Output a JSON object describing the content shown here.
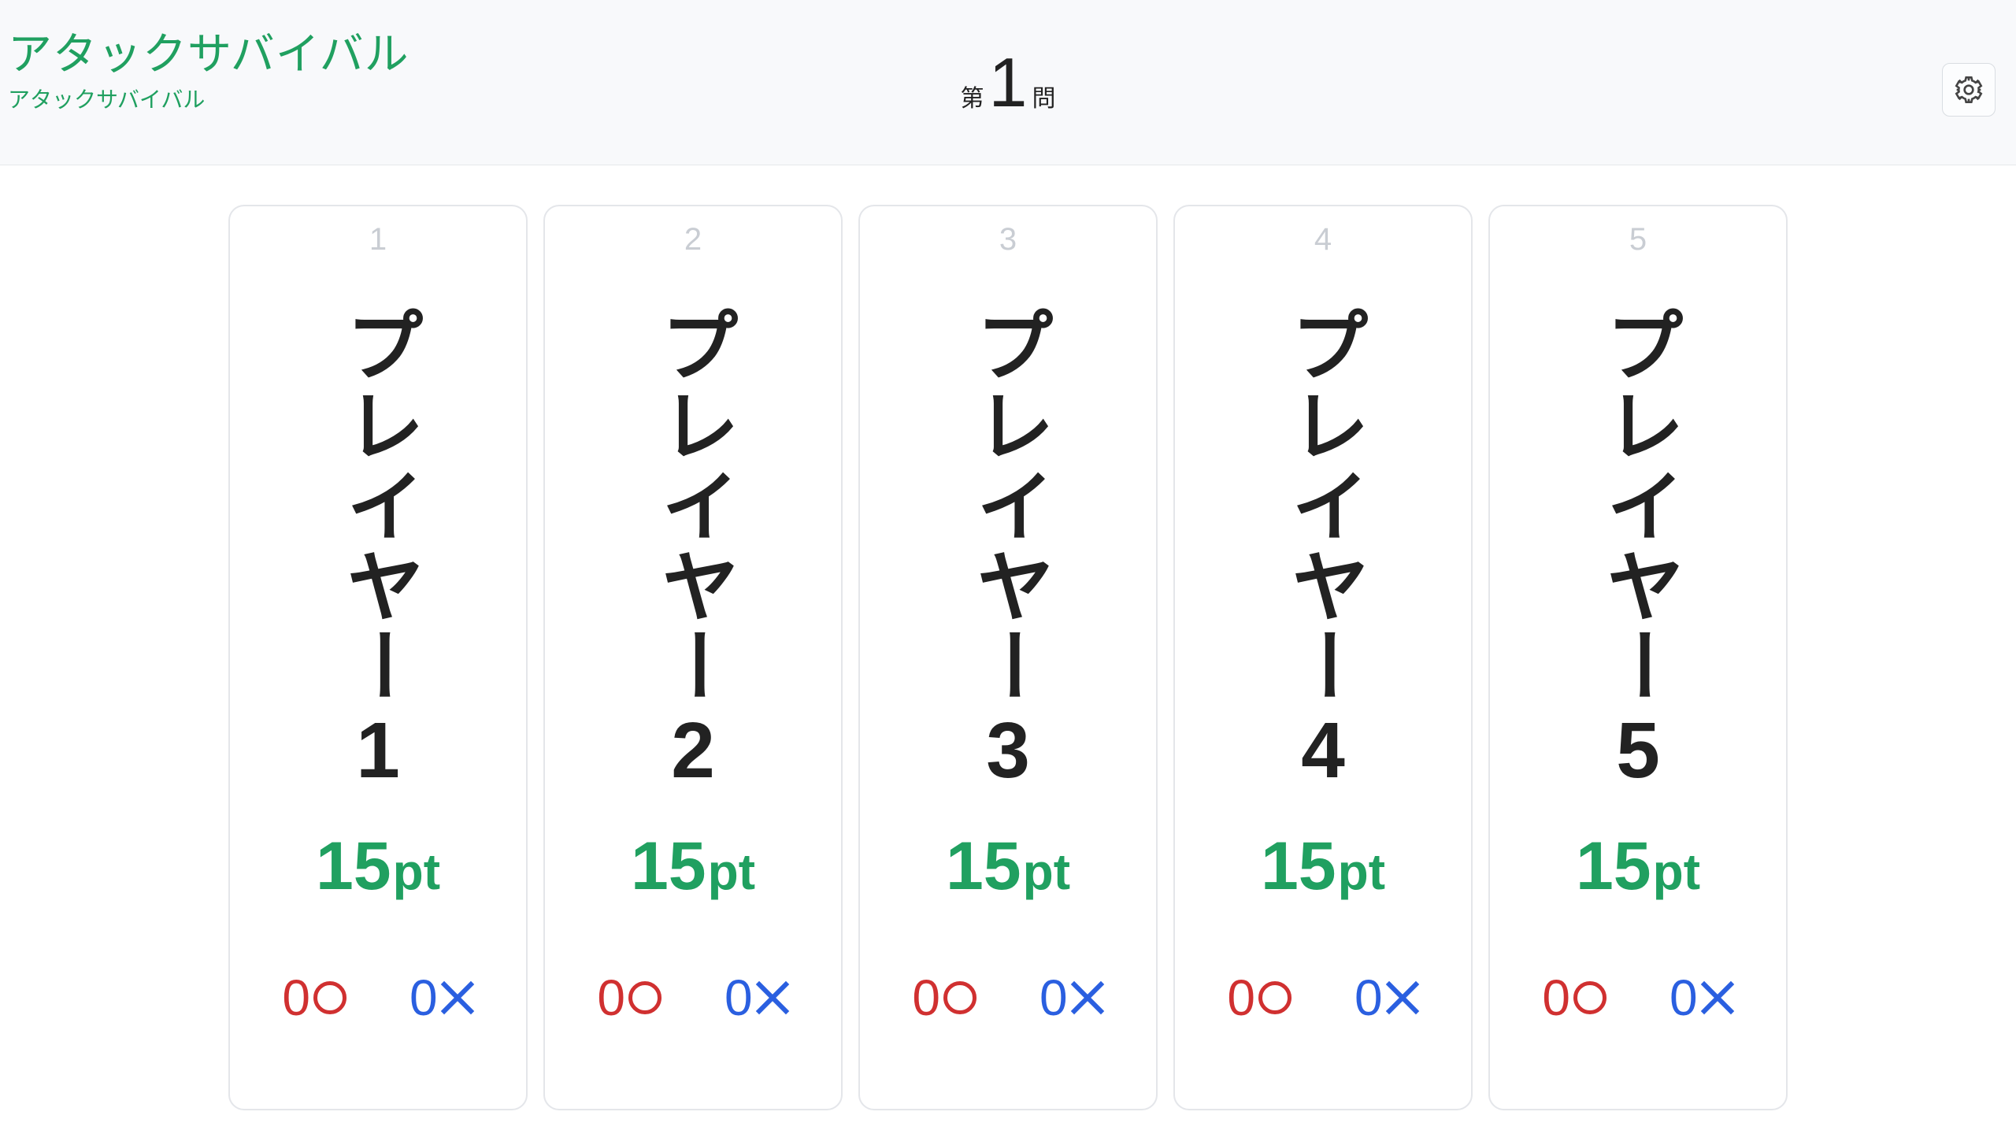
{
  "header": {
    "title": "アタックサバイバル",
    "subtitle": "アタックサバイバル",
    "question_prefix": "第",
    "question_number": "1",
    "question_suffix": "問"
  },
  "points_unit": "pt",
  "players": [
    {
      "index": "1",
      "name": "プレイヤー1",
      "points": "15",
      "correct": "0",
      "wrong": "0"
    },
    {
      "index": "2",
      "name": "プレイヤー2",
      "points": "15",
      "correct": "0",
      "wrong": "0"
    },
    {
      "index": "3",
      "name": "プレイヤー3",
      "points": "15",
      "correct": "0",
      "wrong": "0"
    },
    {
      "index": "4",
      "name": "プレイヤー4",
      "points": "15",
      "correct": "0",
      "wrong": "0"
    },
    {
      "index": "5",
      "name": "プレイヤー5",
      "points": "15",
      "correct": "0",
      "wrong": "0"
    }
  ]
}
